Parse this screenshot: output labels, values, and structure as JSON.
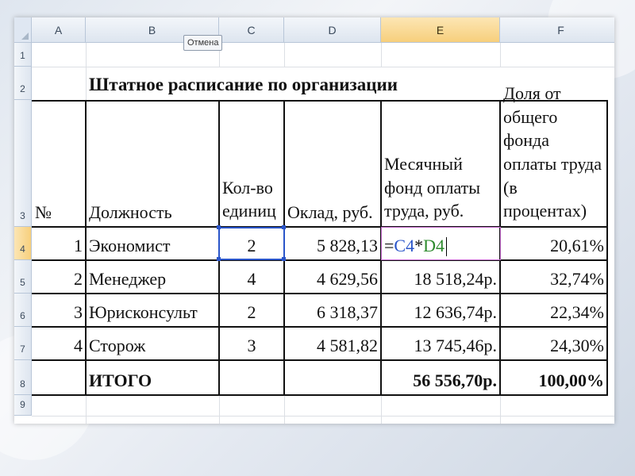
{
  "cancel_label": "Отмена",
  "columns": [
    "A",
    "B",
    "C",
    "D",
    "E",
    "F"
  ],
  "rows": [
    "1",
    "2",
    "3",
    "4",
    "5",
    "6",
    "7",
    "8",
    "9"
  ],
  "title": "Штатное расписание по организации",
  "headers": {
    "num": "№",
    "position": "Должность",
    "count": "Кол-во единиц",
    "salary": "Оклад, руб.",
    "fund": "Месячный фонд оплаты труда, руб.",
    "share": "Доля от общего фонда оплаты труда (в процентах)"
  },
  "data_rows": [
    {
      "num": "1",
      "position": "Экономист",
      "count": "2",
      "salary": "5 828,13",
      "fund": "",
      "share": "20,61%"
    },
    {
      "num": "2",
      "position": "Менеджер",
      "count": "4",
      "salary": "4 629,56",
      "fund": "18 518,24р.",
      "share": "32,74%"
    },
    {
      "num": "3",
      "position": "Юрисконсульт",
      "count": "2",
      "salary": "6 318,37",
      "fund": "12 636,74р.",
      "share": "22,34%"
    },
    {
      "num": "4",
      "position": "Сторож",
      "count": "3",
      "salary": "4 581,82",
      "fund": "13 745,46р.",
      "share": "24,30%"
    }
  ],
  "total": {
    "label": "ИТОГО",
    "fund": "56 556,70р.",
    "share": "100,00%"
  },
  "formula": {
    "prefix": "=",
    "ref1": "C4",
    "op": "*",
    "ref2": "D4"
  },
  "active_column": "E",
  "active_row": "4",
  "colors": {
    "ref1": "#2a55c9",
    "ref2": "#2e8b2e",
    "header_active": "#f7cf7c"
  }
}
